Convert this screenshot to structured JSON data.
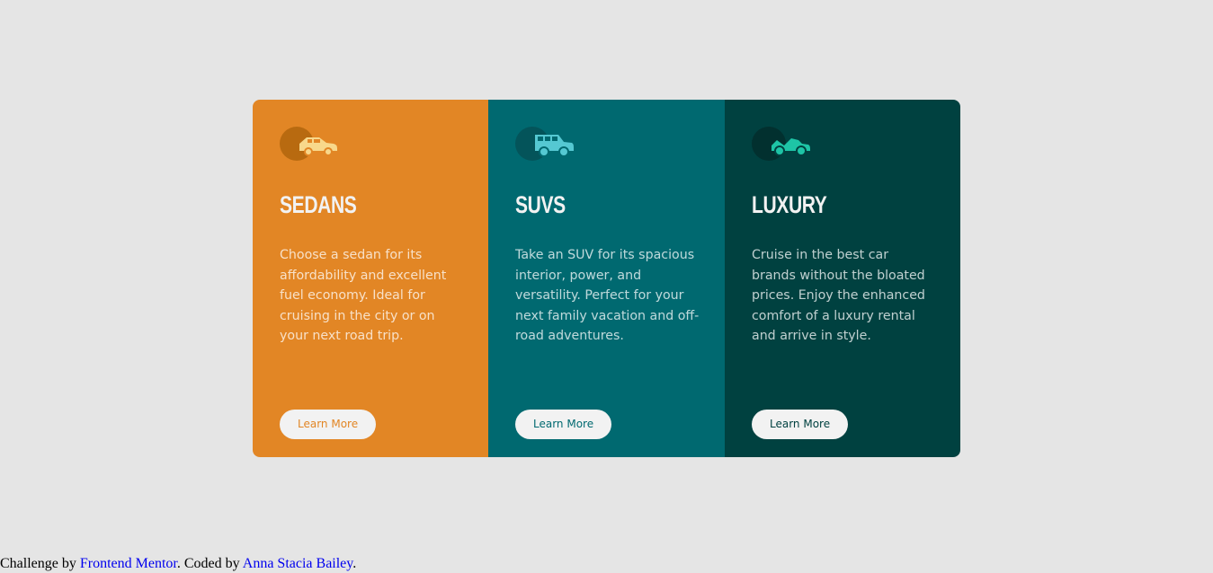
{
  "colors": {
    "page_background": "#e5e5e5",
    "sedans": "#e28625",
    "suvs": "#006970",
    "luxury": "#004140",
    "light_text": "#f2f2f2",
    "icon_sedan": "#f8d88b",
    "icon_suv": "#55c8d2",
    "icon_luxury": "#1ec4a6"
  },
  "cards": [
    {
      "icon": "sedan-car-icon",
      "title": "SEDANS",
      "description": "Choose a sedan for its affordability and excellent fuel economy. Ideal for cruising in the city or on your next road trip.",
      "button": "Learn More"
    },
    {
      "icon": "suv-car-icon",
      "title": "SUVS",
      "description": "Take an SUV for its spacious interior, power, and versatility. Perfect for your next family vacation and off-road adventures.",
      "button": "Learn More"
    },
    {
      "icon": "luxury-car-icon",
      "title": "LUXURY",
      "description": "Cruise in the best car brands without the bloated prices. Enjoy the enhanced comfort of a luxury rental and arrive in style.",
      "button": "Learn More"
    }
  ],
  "attribution": {
    "prefix": "Challenge by ",
    "challenge_link": "Frontend Mentor",
    "middle": ". Coded by ",
    "author_link": "Anna Stacia Bailey",
    "suffix": "."
  }
}
